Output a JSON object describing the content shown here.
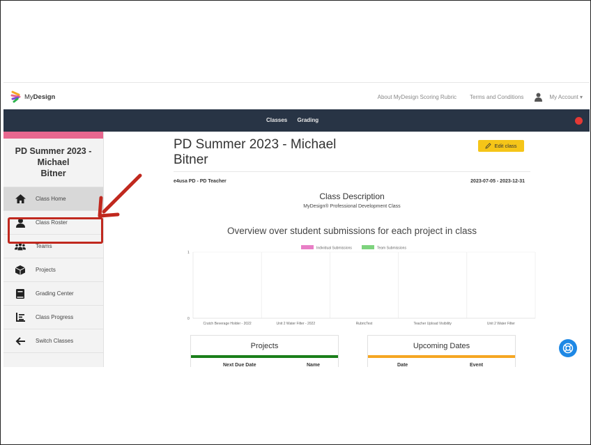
{
  "brand": {
    "prefix": "My",
    "bold": "Design"
  },
  "topnav": {
    "links": [
      "About MyDesign Scoring Rubric",
      "Terms and Conditions"
    ],
    "account": "My Account ▾"
  },
  "darkbar": {
    "links": [
      "Classes",
      "Grading"
    ]
  },
  "sidebar": {
    "class_title_line1": "PD Summer 2023 - Michael",
    "class_title_line2": "Bitner",
    "items": [
      {
        "label": "Class Home",
        "icon": "home-icon"
      },
      {
        "label": "Class Roster",
        "icon": "user-icon"
      },
      {
        "label": "Teams",
        "icon": "team-icon"
      },
      {
        "label": "Projects",
        "icon": "box-icon"
      },
      {
        "label": "Grading Center",
        "icon": "book-icon"
      },
      {
        "label": "Class Progress",
        "icon": "list-icon"
      },
      {
        "label": "Switch Classes",
        "icon": "arrow-left-icon"
      }
    ]
  },
  "main": {
    "title_line1": "PD Summer 2023 - Michael",
    "title_line2": "Bitner",
    "edit_label": "Edit class",
    "school": "e4usa PD - PD Teacher",
    "dates": "2023-07-05 - 2023-12-31",
    "desc_title": "Class Description",
    "desc_text": "MyDesign® Professional Development Class",
    "overview_title": "Overview over student submissions for each project in class"
  },
  "chart_data": {
    "type": "bar",
    "categories": [
      "Crutch Beverage Holder - 2022",
      "Unit 2 Water Filter - 2022",
      "RubricTest",
      "Teacher Upload Visibility",
      "Unit 2 Water Filter"
    ],
    "series": [
      {
        "name": "Individual Submissions",
        "values": [
          0,
          0,
          0,
          0,
          0
        ],
        "color": "#e87fc6"
      },
      {
        "name": "Team Submissions",
        "values": [
          0,
          0,
          0,
          0,
          0
        ],
        "color": "#7ed37e"
      }
    ],
    "ylim": [
      0,
      1
    ],
    "yticks": [
      "1",
      "0"
    ],
    "grid": true,
    "legend": "top"
  },
  "cards": {
    "projects": {
      "title": "Projects",
      "col1": "Next Due Date",
      "col2": "Name",
      "color": "#1a7f1a"
    },
    "dates": {
      "title": "Upcoming Dates",
      "col1": "Date",
      "col2": "Event",
      "color": "#f5a623"
    }
  }
}
